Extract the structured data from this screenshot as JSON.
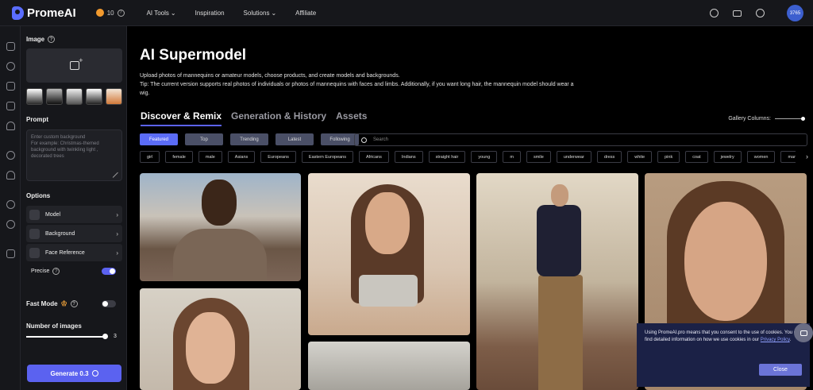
{
  "header": {
    "brand": "PromeAI",
    "credits": "10",
    "nav": [
      "AI Tools",
      "Inspiration",
      "Solutions",
      "Affiliate"
    ],
    "nav_chevrons": [
      "⌄",
      "",
      "⌄",
      ""
    ],
    "avatar_text": "3765"
  },
  "sidebar": {
    "image_title": "Image",
    "prompt_title": "Prompt",
    "prompt_placeholder": "Enter custom background\nFor example: Christmas-themed background with twinkling light , decorated trees",
    "options_title": "Options",
    "options": [
      {
        "label": "Model",
        "chevron": "›"
      },
      {
        "label": "Background",
        "chevron": "›"
      },
      {
        "label": "Face Reference",
        "chevron": "›"
      }
    ],
    "precise_label": "Precise",
    "fast_mode_label": "Fast Mode",
    "num_images_label": "Number of images",
    "num_images_value": "3",
    "generate_label": "Generate 0.3"
  },
  "main": {
    "title": "AI Supermodel",
    "desc_line1": "Upload photos of mannequins or amateur models, choose products, and create models and backgrounds.",
    "desc_line2": "Tip: The current version supports real photos of individuals or photos of mannequins with faces and limbs. Additionally, if you want long hair, the mannequin model should wear a wig.",
    "tabs": [
      "Discover & Remix",
      "Generation & History",
      "Assets"
    ],
    "gallery_columns_label": "Gallery Columns:",
    "filters": [
      "Featured",
      "Top",
      "Trending",
      "Latest",
      "Following"
    ],
    "search_placeholder": "Search",
    "chips": [
      "girl",
      "female",
      "male",
      "Asians",
      "Europeans",
      "Eastern Europeans",
      "Africans",
      "Indians",
      "straight hair",
      "young",
      "m",
      "smile",
      "underwear",
      "dress",
      "white",
      "pink",
      "coat",
      "jewelry",
      "women",
      "man"
    ],
    "chips_more": "›"
  },
  "cookie": {
    "text": "Using PromeAI.pro means that you consent to the use of cookies. You can find detailed information on how we use cookies in our ",
    "link": "Privacy Policy",
    "close_label": "Close"
  },
  "colors": {
    "accent": "#5b62f0",
    "panel_bg": "#16171b"
  }
}
